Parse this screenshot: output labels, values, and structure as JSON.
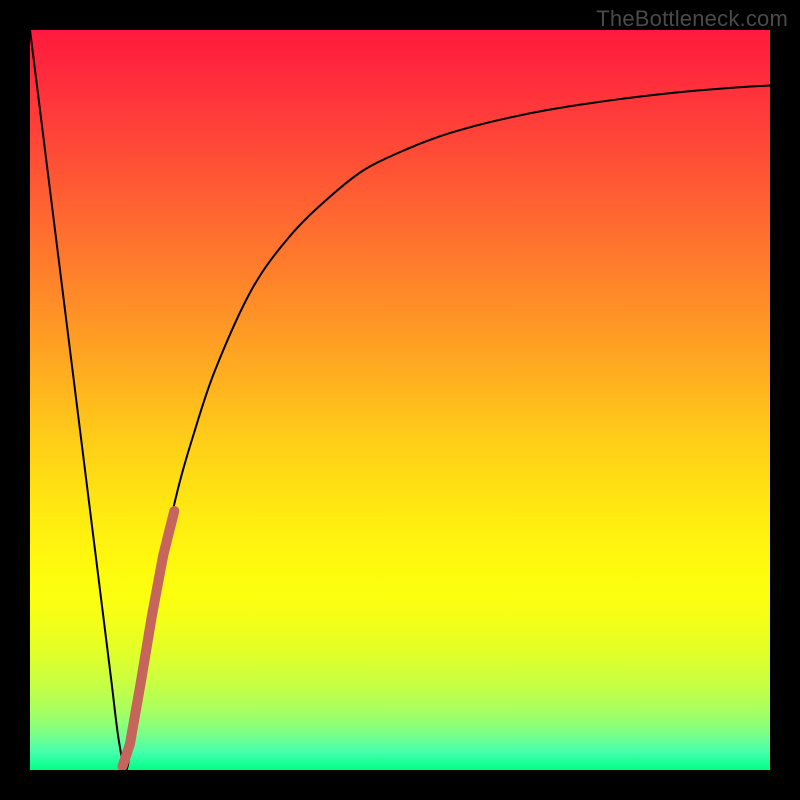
{
  "watermark": "TheBottleneck.com",
  "chart_data": {
    "type": "line",
    "title": "",
    "xlabel": "",
    "ylabel": "",
    "xlim": [
      0,
      100
    ],
    "ylim": [
      0,
      100
    ],
    "grid": false,
    "legend": false,
    "series": [
      {
        "name": "bottleneck-curve",
        "color": "#000000",
        "stroke_width": 2,
        "x": [
          0,
          2,
          4,
          6,
          8,
          10,
          11,
          12,
          13,
          14,
          16,
          18,
          20,
          22,
          25,
          30,
          35,
          40,
          45,
          50,
          55,
          60,
          65,
          70,
          75,
          80,
          85,
          90,
          95,
          100
        ],
        "values": [
          100,
          84,
          68,
          52,
          36,
          20,
          12,
          4,
          0,
          6,
          18,
          29,
          38,
          45,
          54,
          65,
          72,
          77,
          81,
          83.5,
          85.5,
          87,
          88.2,
          89.2,
          90,
          90.7,
          91.3,
          91.8,
          92.2,
          92.5
        ]
      },
      {
        "name": "highlight-segment",
        "color": "#c5655c",
        "stroke_width": 10,
        "x": [
          12.5,
          13.5,
          15,
          16.5,
          18,
          19.5
        ],
        "values": [
          0.5,
          3.5,
          12,
          21,
          29,
          35
        ]
      }
    ],
    "background_gradient": {
      "direction": "top-to-bottom",
      "stops": [
        {
          "pos": 0,
          "color": "#ff1a3c"
        },
        {
          "pos": 26,
          "color": "#ff6a30"
        },
        {
          "pos": 56,
          "color": "#ffcf18"
        },
        {
          "pos": 76,
          "color": "#fdff0f"
        },
        {
          "pos": 92,
          "color": "#a8ff60"
        },
        {
          "pos": 100,
          "color": "#00ff88"
        }
      ]
    }
  }
}
